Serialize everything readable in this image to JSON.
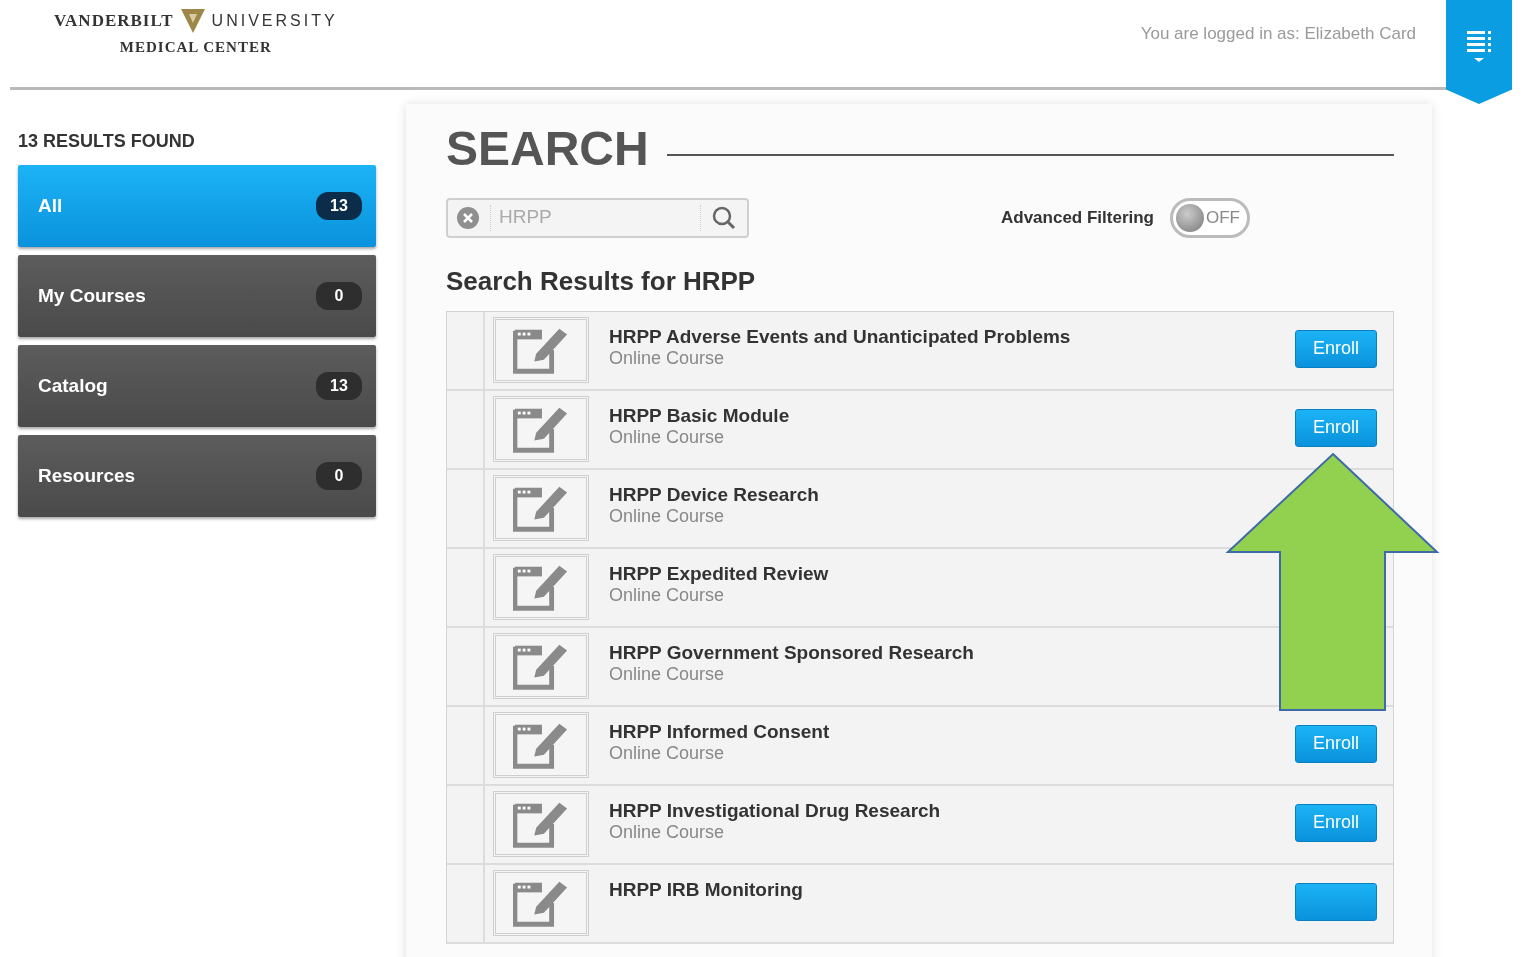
{
  "header": {
    "logo": {
      "left": "VANDERBILT",
      "right": "UNIVERSITY",
      "subtitle": "MEDICAL CENTER"
    },
    "login_text": "You are logged in as: Elizabeth Card"
  },
  "sidebar": {
    "results_found": "13 RESULTS FOUND",
    "items": [
      {
        "label": "All",
        "count": "13",
        "selected": true
      },
      {
        "label": "My Courses",
        "count": "0",
        "selected": false
      },
      {
        "label": "Catalog",
        "count": "13",
        "selected": false
      },
      {
        "label": "Resources",
        "count": "0",
        "selected": false
      }
    ]
  },
  "main": {
    "title": "SEARCH",
    "search": {
      "value": "HRPP"
    },
    "advanced_filtering": {
      "label": "Advanced Filtering",
      "on": false,
      "state_text": "OFF"
    },
    "results_heading": "Search Results for HRPP",
    "results": [
      {
        "title": "HRPP Adverse Events and Unanticipated Problems",
        "subtitle": "Online Course",
        "kind": "enroll",
        "button_label": "Enroll"
      },
      {
        "title": "HRPP Basic Module",
        "subtitle": "Online Course",
        "kind": "enroll",
        "button_label": "Enroll"
      },
      {
        "title": "HRPP Device Research",
        "subtitle": "Online Course",
        "kind": "plain"
      },
      {
        "title": "HRPP Expedited Review",
        "subtitle": "Online Course",
        "kind": "plain"
      },
      {
        "title": "HRPP Government Sponsored Research",
        "subtitle": "Online Course",
        "kind": "plain"
      },
      {
        "title": "HRPP Informed Consent",
        "subtitle": "Online Course",
        "kind": "enroll",
        "button_label": "Enroll"
      },
      {
        "title": "HRPP Investigational Drug Research",
        "subtitle": "Online Course",
        "kind": "enroll",
        "button_label": "Enroll"
      },
      {
        "title": "HRPP IRB Monitoring",
        "kind": "enroll"
      }
    ]
  },
  "annotation": {
    "kind": "up_arrow"
  }
}
